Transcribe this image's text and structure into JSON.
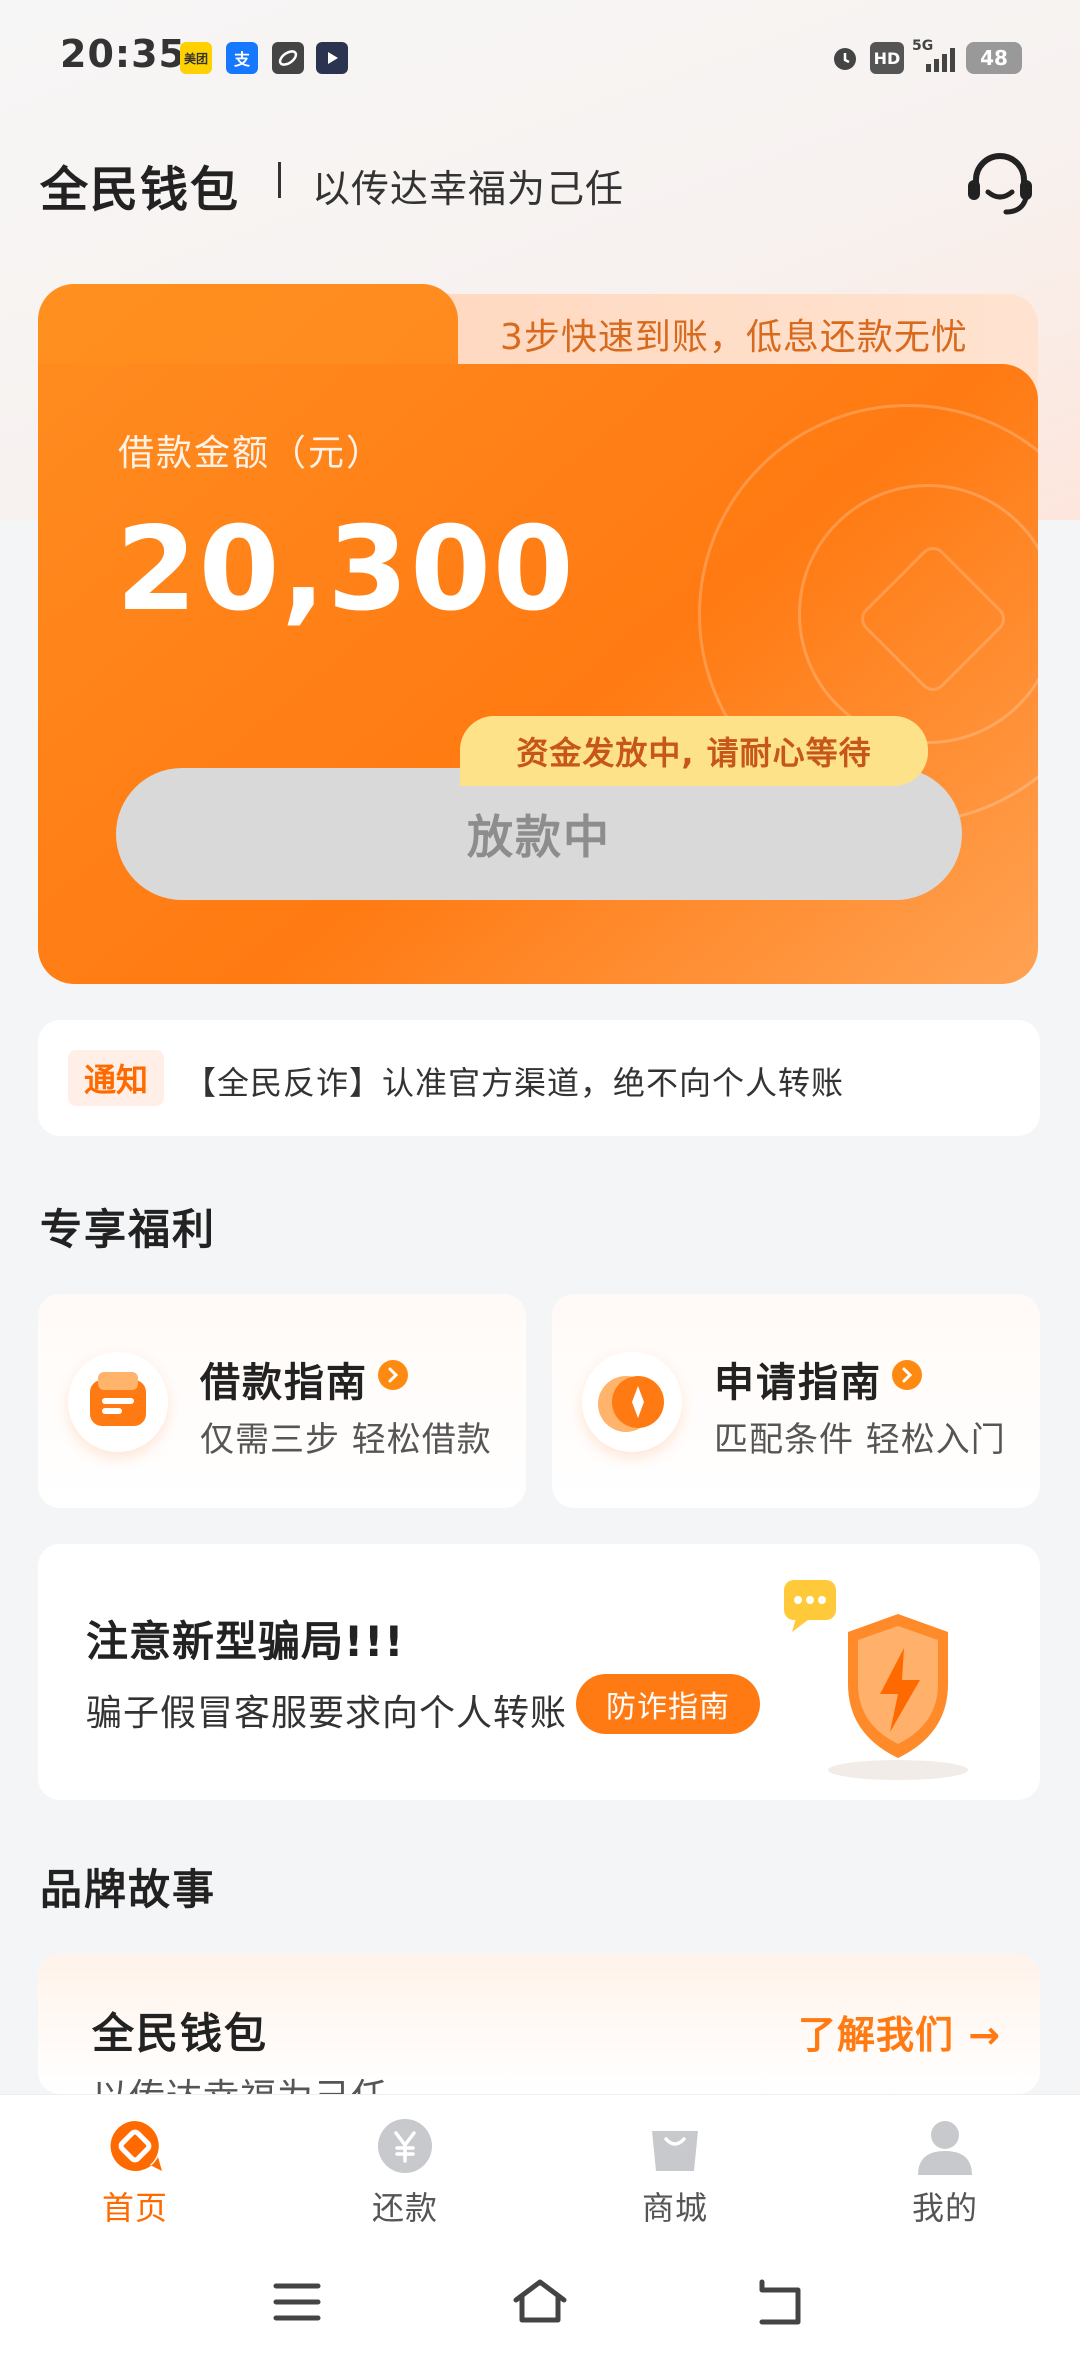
{
  "status_bar": {
    "time": "20:35",
    "app_icons": [
      "meituan-icon",
      "alipay-icon",
      "app-icon",
      "media-icon"
    ],
    "meituan_text": "美团",
    "alipay_text": "支",
    "hd_text": "HD",
    "network_text": "5G",
    "battery_level": "48"
  },
  "header": {
    "brand": "全民钱包",
    "slogan": "以传达幸福为己任"
  },
  "loan_card": {
    "tab_slogan": "3步快速到账，低息还款无忧",
    "amount_label": "借款金额（元）",
    "amount": "20,300",
    "tip": "资金发放中, 请耐心等待",
    "status_button": "放款中"
  },
  "notice": {
    "tag": "通知",
    "text": "【全民反诈】认准官方渠道，绝不向个人转账"
  },
  "benefits": {
    "title": "专享福利",
    "items": [
      {
        "title": "借款指南",
        "subtitle": "仅需三步  轻松借款"
      },
      {
        "title": "申请指南",
        "subtitle": "匹配条件  轻松入门"
      }
    ]
  },
  "scam": {
    "title": "注意新型骗局!!!",
    "subtitle": "骗子假冒客服要求向个人转账",
    "button": "防诈指南"
  },
  "brand_story": {
    "title": "品牌故事",
    "card_title": "全民钱包",
    "card_subtitle": "以传达幸福为己任",
    "link": "了解我们 →"
  },
  "tabs": [
    {
      "label": "首页",
      "active": true
    },
    {
      "label": "还款",
      "active": false
    },
    {
      "label": "商城",
      "active": false
    },
    {
      "label": "我的",
      "active": false
    }
  ],
  "colors": {
    "accent": "#ff7a12",
    "tip_bg": "#fde28a",
    "status_button_bg": "#d9d9d9"
  }
}
